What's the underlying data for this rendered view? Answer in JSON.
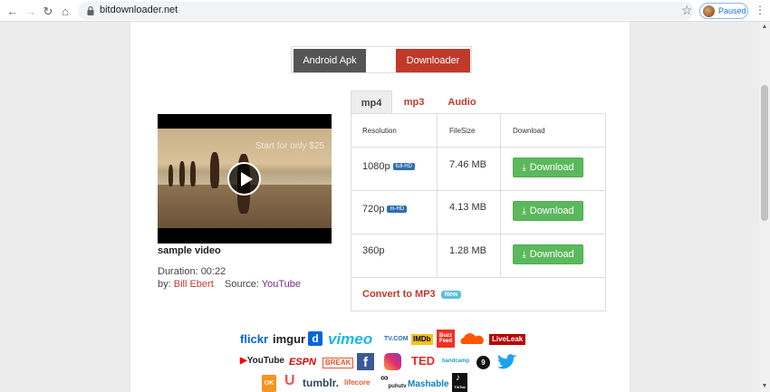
{
  "browser": {
    "url": "bitdownloader.net",
    "profile_status": "Paused"
  },
  "buttons": {
    "android_apk": "Android Apk",
    "downloader": "Downloader"
  },
  "video": {
    "overlay_text": "Start for only $25",
    "title": "sample video",
    "duration": "Duration: 00:22",
    "by_label": "by:",
    "author": "Bill Ebert",
    "source_label": "Source:",
    "source": "YouTube"
  },
  "tabs": [
    "mp4",
    "mp3",
    "Audio"
  ],
  "table": {
    "headers": [
      "Resolution",
      "FileSize",
      "Download"
    ],
    "rows": [
      {
        "resolution": "1080p",
        "badge": "full-HD",
        "size": "7.46 MB",
        "button": "Download"
      },
      {
        "resolution": "720p",
        "badge": "m-HD",
        "size": "4.13 MB",
        "button": "Download"
      },
      {
        "resolution": "360p",
        "badge": "",
        "size": "1.28 MB",
        "button": "Download"
      }
    ],
    "convert": "Convert to MP3",
    "new_badge": "New"
  },
  "logos": {
    "flickr": "flickr",
    "imgur": "imgur",
    "d": "d",
    "vimeo": "vimeo",
    "tvcom": "TV.COM",
    "imdb": "IMDb",
    "buzzfeed": "Buzz Feed",
    "liveleak": "LiveLeak",
    "youtube": "YouTube",
    "espn": "ESPN",
    "break": "BREAK",
    "facebook": "f",
    "ted": "TED",
    "bandcamp": "bandcamp",
    "nine": "9",
    "ok": "OK",
    "udemy": "U",
    "tumblr": "tumblr.",
    "lifestyle": "lifecore",
    "puhu": "puhutv",
    "mashable": "Mashable",
    "tiktok_label": "TikTok"
  },
  "colors": {
    "accent_red": "#c0392b",
    "success_green": "#5cb85c",
    "dark_button": "#555555"
  }
}
